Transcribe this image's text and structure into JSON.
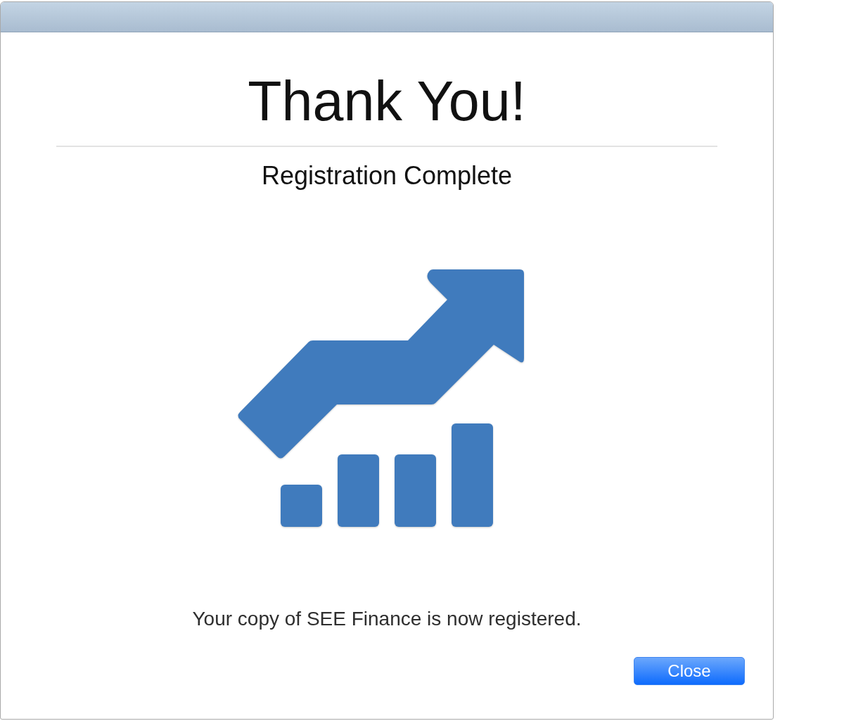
{
  "dialog": {
    "heading": "Thank You!",
    "subheading": "Registration Complete",
    "message": "Your copy of SEE Finance is now registered."
  },
  "buttons": [
    {
      "label": "Close",
      "kind": "default"
    }
  ]
}
